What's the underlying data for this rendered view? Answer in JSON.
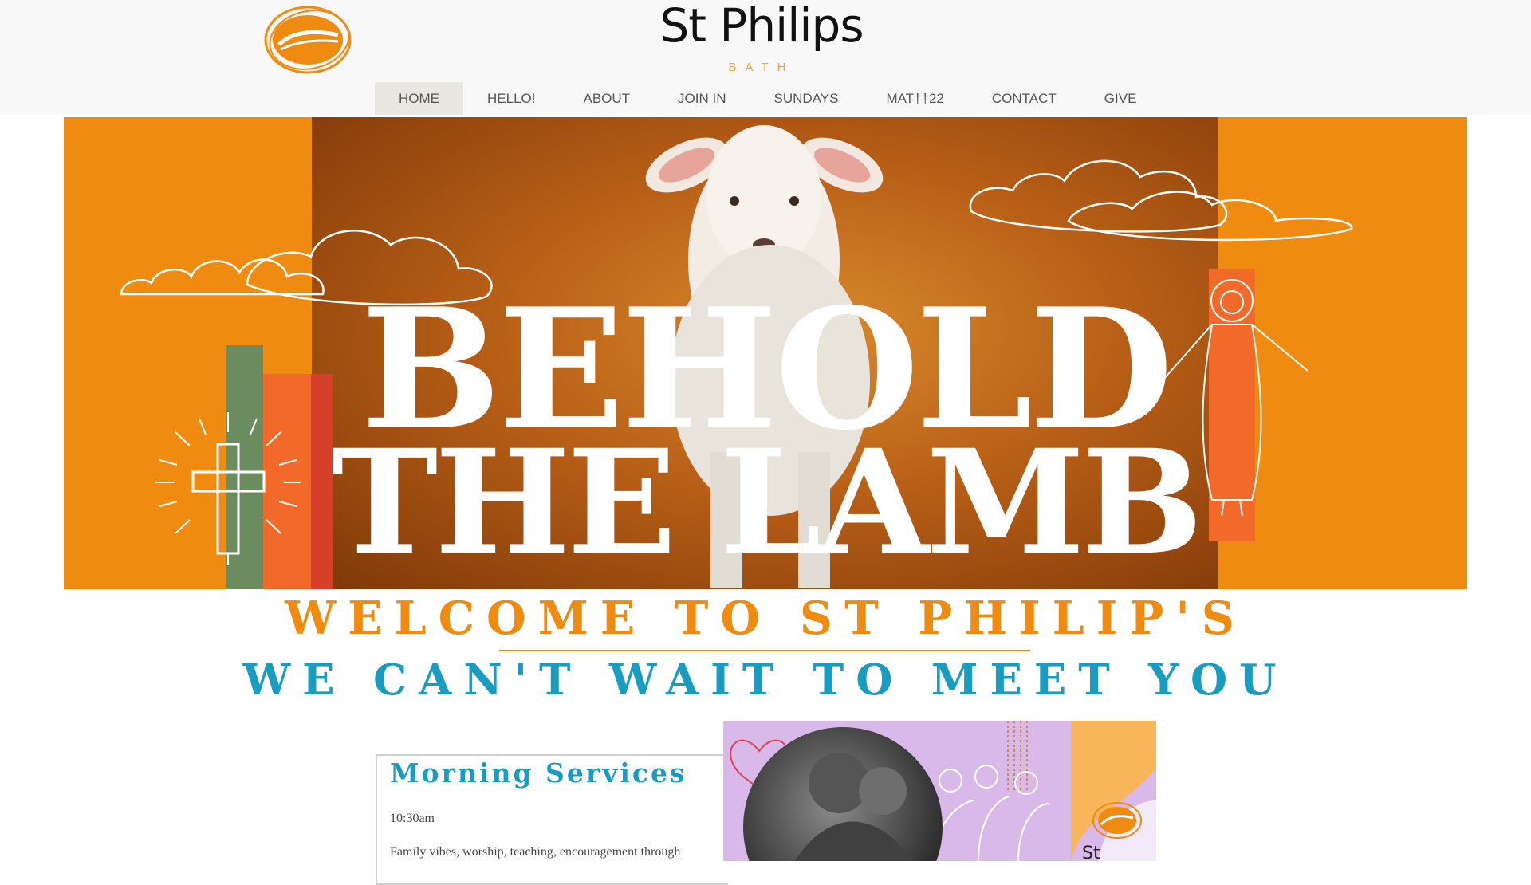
{
  "site": {
    "title": "St Philips",
    "subtitle": "BATH"
  },
  "nav": {
    "items": [
      {
        "label": "HOME",
        "active": true
      },
      {
        "label": "HELLO!",
        "active": false
      },
      {
        "label": "ABOUT",
        "active": false
      },
      {
        "label": "JOIN IN",
        "active": false
      },
      {
        "label": "SUNDAYS",
        "active": false
      },
      {
        "label": "MAT††22",
        "active": false
      },
      {
        "label": "CONTACT",
        "active": false
      },
      {
        "label": "GIVE",
        "active": false
      }
    ]
  },
  "hero": {
    "line1": "BEHOLD",
    "line2": "THE LAMB"
  },
  "welcome": {
    "heading": "WELCOME TO ST PHILIP'S",
    "tagline": "WE CAN'T WAIT TO MEET YOU"
  },
  "services": {
    "title": "Morning Services",
    "time": "10:30am",
    "description": "Family vibes, worship, teaching, encouragement through"
  },
  "promo": {
    "brand": "St Philips"
  },
  "colors": {
    "brand_orange": "#ee8b10",
    "accent_blue": "#1a9cc1",
    "promo_lilac": "#d8b9ea"
  },
  "icons": [
    "church-logo-icon",
    "cross-icon",
    "clouds-icon",
    "lamb-image",
    "jesus-figure-icon",
    "heart-icon"
  ]
}
